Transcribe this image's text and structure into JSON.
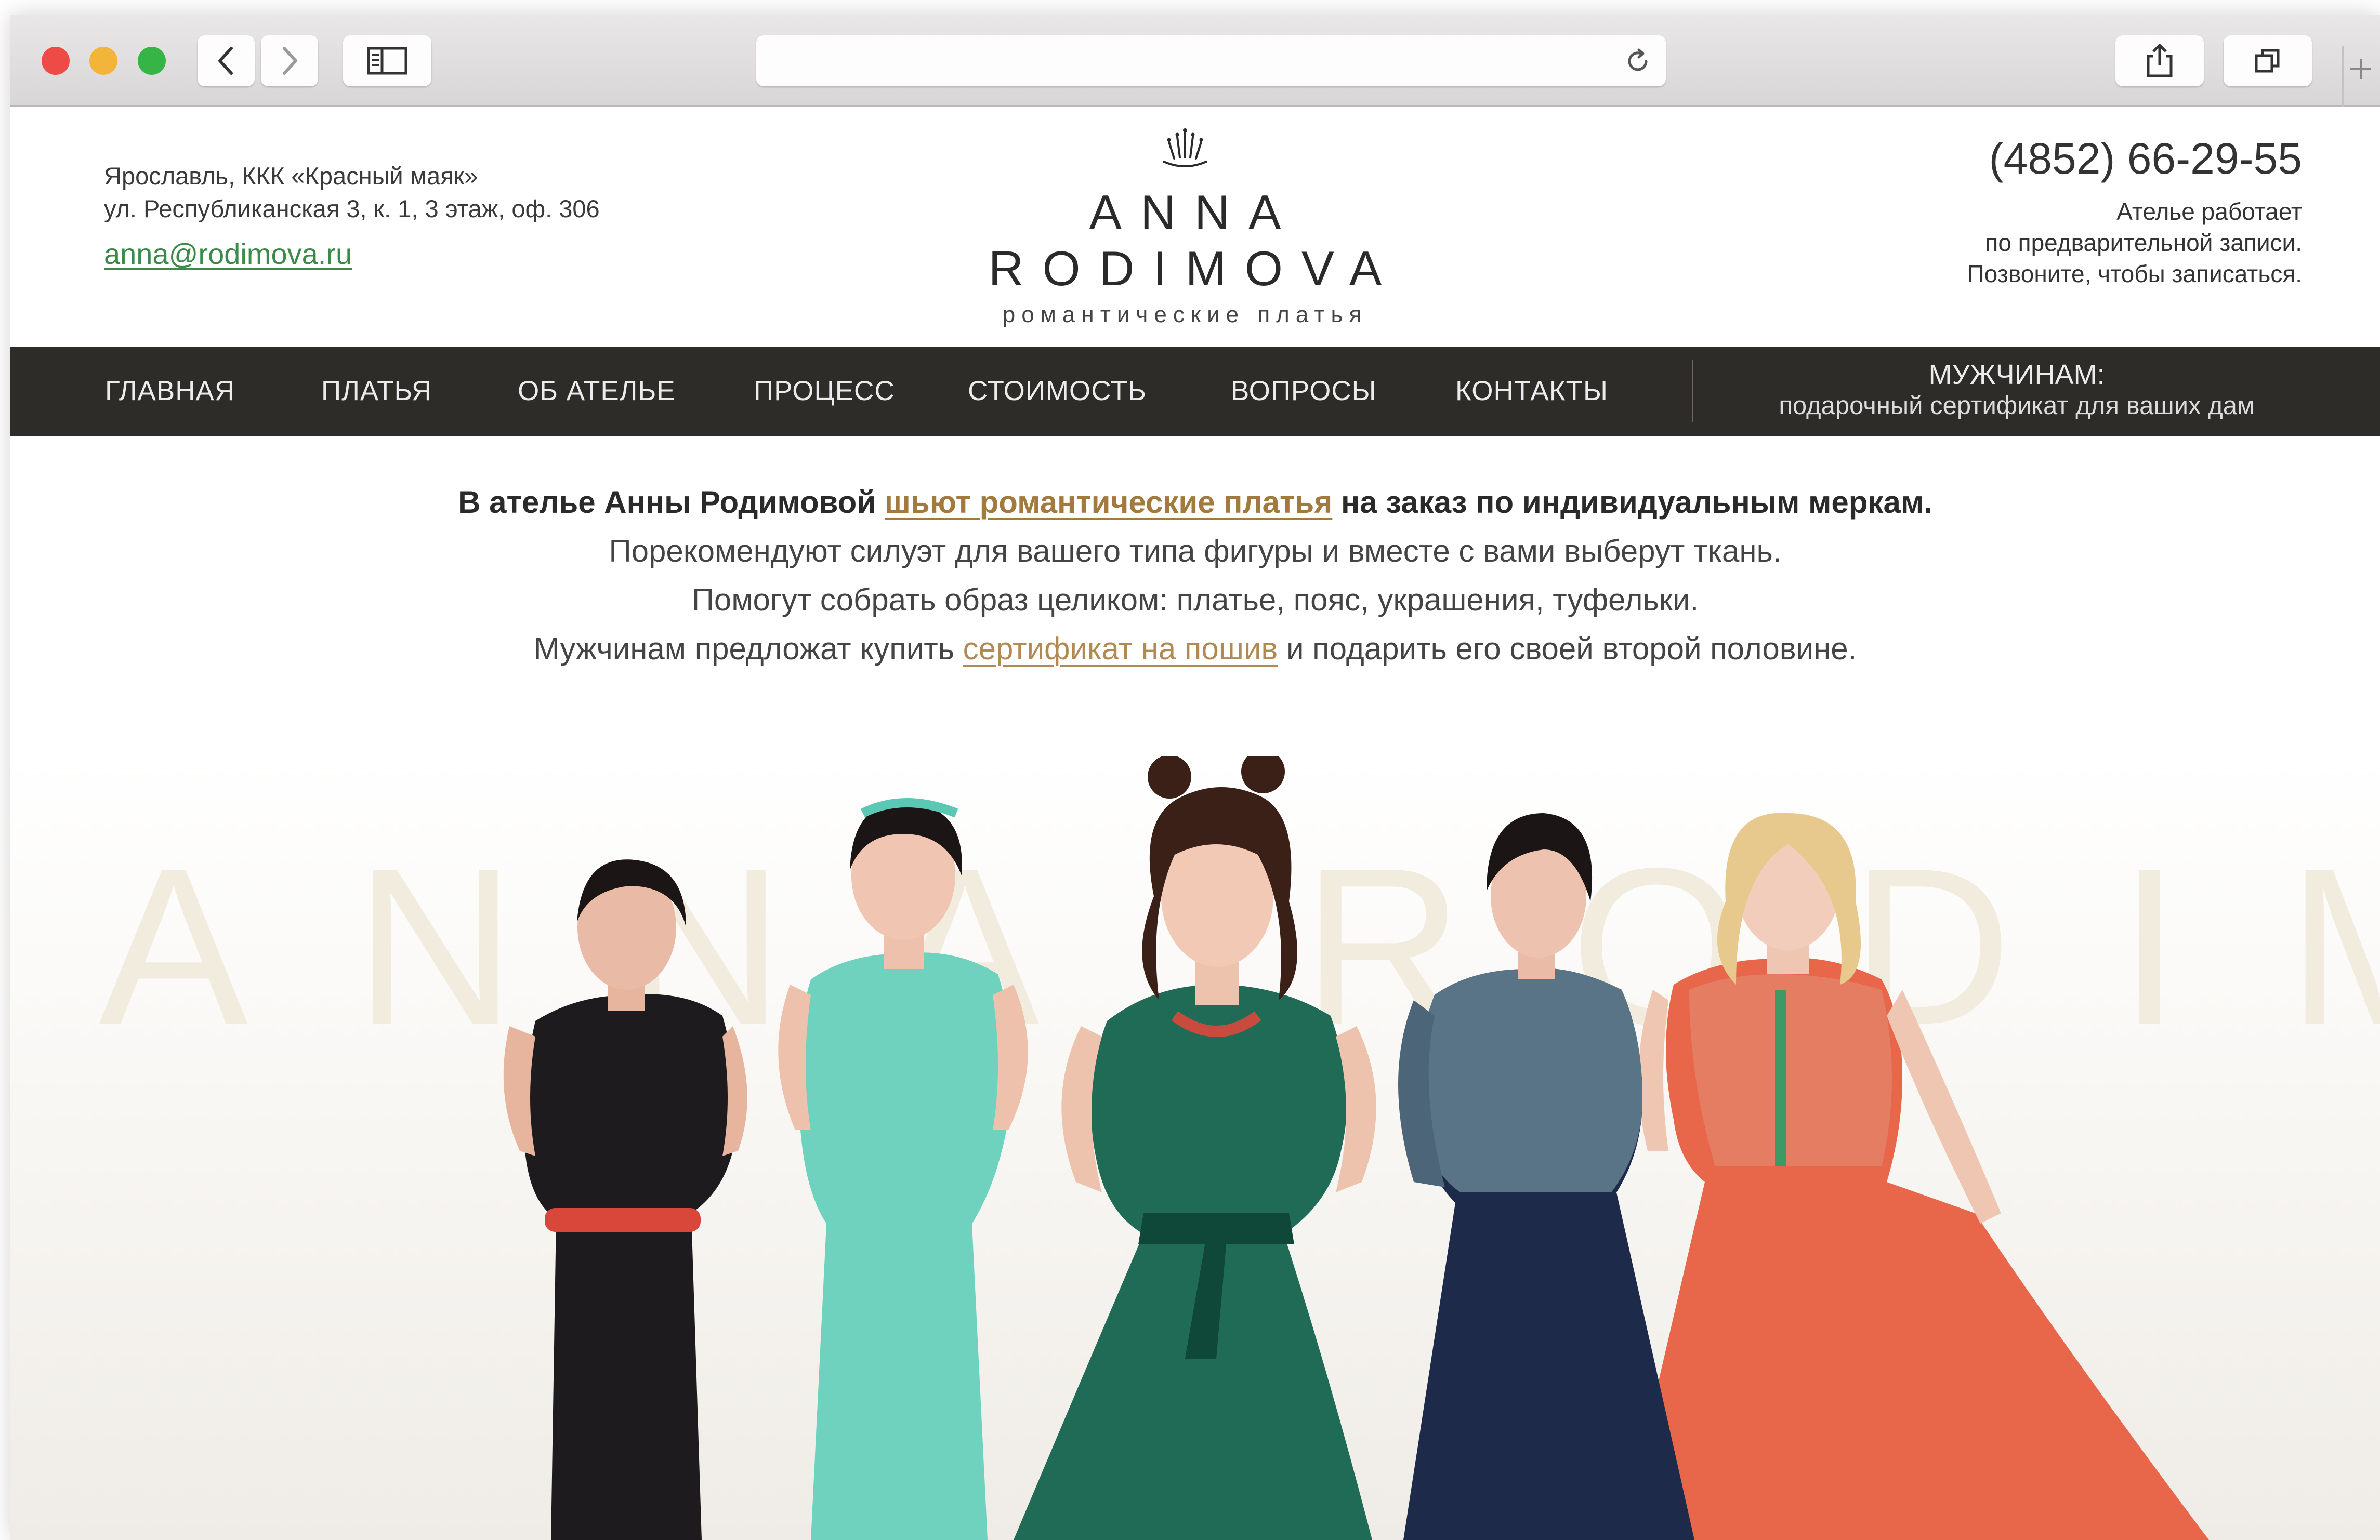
{
  "browser": {
    "url": "",
    "icons": {
      "back": "chevron-left-icon",
      "forward": "chevron-right-icon",
      "sidebar": "sidebar-icon",
      "reload": "reload-icon",
      "share": "share-icon",
      "tabs": "tabs-icon",
      "new_tab": "plus-icon"
    },
    "colors": {
      "close": "#ee4a46",
      "minimize": "#f3b43a",
      "zoom": "#36b546"
    }
  },
  "header": {
    "address_line1": "Ярославль, ККК «Красный маяк»",
    "address_line2": "ул. Республиканская 3, к. 1, 3 этаж, оф. 306",
    "email": "anna@rodimova.ru",
    "brand": "ANNA RODIMOVA",
    "tagline": "романтические платья",
    "phone": "(4852) 66-29-55",
    "note_line1": "Ателье работает",
    "note_line2": "по предварительной записи.",
    "note_line3": "Позвоните, чтобы записаться."
  },
  "nav": {
    "items": [
      {
        "label": "ГЛАВНАЯ"
      },
      {
        "label": "ПЛАТЬЯ"
      },
      {
        "label": "ОБ АТЕЛЬЕ"
      },
      {
        "label": "ПРОЦЕСС"
      },
      {
        "label": "СТОИМОСТЬ"
      },
      {
        "label": "ВОПРОСЫ"
      },
      {
        "label": "КОНТАКТЫ"
      }
    ],
    "men_title": "МУЖЧИНАМ:",
    "men_sub": "подарочный сертификат для ваших дам"
  },
  "intro": {
    "l1_a": "В ателье Анны Родимовой ",
    "l1_link": "шьют романтические платья",
    "l1_b": " на заказ по индивидуальным меркам.",
    "l2": "Порекомендуют силуэт для вашего типа фигуры и вместе с вами выберут ткань.",
    "l3": "Помогут собрать образ целиком: платье, пояс, украшения, туфельки.",
    "l4_a": "Мужчинам предложат купить ",
    "l4_link": "сертификат на пошив",
    "l4_b": " и подарить его своей второй половине."
  },
  "hero": {
    "watermark": "ANNA RODIMOVA",
    "dress_colors": [
      "#1d1b1e",
      "#6fd2bf",
      "#1f6b55",
      "#1d2a4a",
      "#e8674a"
    ]
  }
}
